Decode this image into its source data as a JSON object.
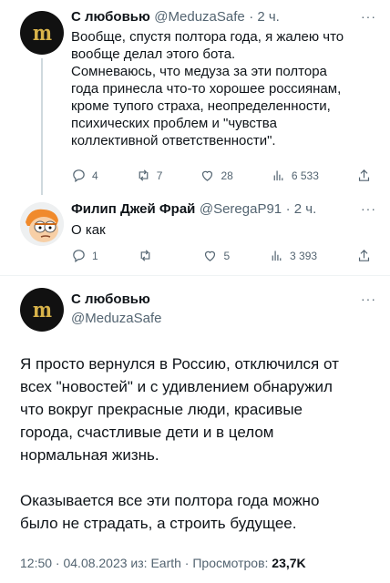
{
  "tweet1": {
    "name": "С любовью",
    "handle": "@MeduzaSafe",
    "time": "· 2 ч.",
    "more": "···",
    "avatar_text": "m",
    "text": "Вообще, спустя полтора года, я жалею что\nвообще делал этого бота.\nСомневаюсь, что медуза за эти полтора\nгода принесла что-то хорошее россиянам,\nкроме тупого страха, неопределенности,\nпсихических проблем и \"чувства\nколлективной ответственности\".",
    "replies": "4",
    "retweets": "7",
    "likes": "28",
    "views": "6 533"
  },
  "tweet2": {
    "name": "Филип Джей Фрай",
    "handle": "@SeregaP91",
    "time": "· 2 ч.",
    "more": "···",
    "text": "О как",
    "replies": "1",
    "retweets": "",
    "likes": "5",
    "views": "3 393"
  },
  "main": {
    "name": "С любовью",
    "handle": "@MeduzaSafe",
    "more": "···",
    "avatar_text": "m",
    "paragraph1": "Я просто вернулся в Россию, отключился от\nвсех \"новостей\" и с удивлением обнаружил\nчто вокруг прекрасные люди, красивые\nгорода, счастливые дети и в целом\nнормальная жизнь.",
    "paragraph2": "Оказывается все эти полтора года можно\nбыло не страдать, а строить будущее.",
    "meta_prefix": "12:50 · 04.08.2023 из: Earth · Просмотров: ",
    "views": "23,7K"
  }
}
